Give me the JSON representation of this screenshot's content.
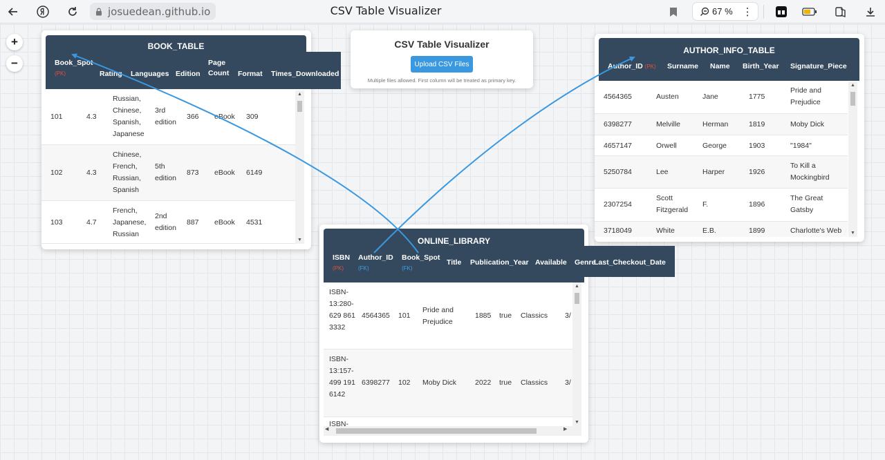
{
  "browser": {
    "domain": "josuedean.github.io",
    "tab_title": "CSV Table Visualizer",
    "zoom": "67 %",
    "menu": "⋮"
  },
  "canvas_controls": {
    "zoom_in": "+",
    "zoom_out": "−"
  },
  "uploader": {
    "title": "CSV Table Visualizer",
    "button": "Upload CSV Files",
    "hint": "Multiple files allowed. First column will be treated as primary key."
  },
  "book_table": {
    "title": "BOOK_TABLE",
    "columns": [
      {
        "label": "Book_Spot",
        "tag": "(PK)"
      },
      {
        "label": "Rating"
      },
      {
        "label": "Languages"
      },
      {
        "label": "Edition"
      },
      {
        "label": "Page Count"
      },
      {
        "label": "Format"
      },
      {
        "label": "Times_Downloaded"
      }
    ],
    "rows": [
      {
        "spot": "101",
        "rating": "4.3",
        "languages": "Russian, Chinese, Spanish, Japanese",
        "edition": "3rd edition",
        "pages": "366",
        "format": "eBook",
        "downloads": "309"
      },
      {
        "spot": "102",
        "rating": "4.3",
        "languages": "Chinese, French, Russian, Spanish",
        "edition": "5th edition",
        "pages": "873",
        "format": "eBook",
        "downloads": "6149"
      },
      {
        "spot": "103",
        "rating": "4.7",
        "languages": "French, Japanese, Russian",
        "edition": "2nd edition",
        "pages": "887",
        "format": "eBook",
        "downloads": "4531"
      }
    ]
  },
  "author_table": {
    "title": "AUTHOR_INFO_TABLE",
    "columns": [
      {
        "label": "Author_ID",
        "tag": "(PK)"
      },
      {
        "label": "Surname"
      },
      {
        "label": "Name"
      },
      {
        "label": "Birth_Year"
      },
      {
        "label": "Signature_Piece"
      }
    ],
    "rows": [
      {
        "id": "4564365",
        "surname": "Austen",
        "name": "Jane",
        "year": "1775",
        "piece": "Pride and Prejudice"
      },
      {
        "id": "6398277",
        "surname": "Melville",
        "name": "Herman",
        "year": "1819",
        "piece": "Moby Dick"
      },
      {
        "id": "4657147",
        "surname": "Orwell",
        "name": "George",
        "year": "1903",
        "piece": "\"1984\""
      },
      {
        "id": "5250784",
        "surname": "Lee",
        "name": "Harper",
        "year": "1926",
        "piece": "To Kill a Mockingbird"
      },
      {
        "id": "2307254",
        "surname": "Scott Fitzgerald",
        "name": "F.",
        "year": "1896",
        "piece": "The Great Gatsby"
      },
      {
        "id": "3718049",
        "surname": "White",
        "name": "E.B.",
        "year": "1899",
        "piece": "Charlotte's Web"
      }
    ]
  },
  "library_table": {
    "title": "ONLINE_LIBRARY",
    "columns": [
      {
        "label": "ISBN",
        "tag": "(PK)",
        "tag_type": "pk"
      },
      {
        "label": "Author_ID",
        "tag": "(FK)",
        "tag_type": "fk"
      },
      {
        "label": "Book_Spot",
        "tag": "(FK)",
        "tag_type": "fk"
      },
      {
        "label": "Title"
      },
      {
        "label": "Publication_Year"
      },
      {
        "label": "Available"
      },
      {
        "label": "Genre"
      },
      {
        "label": "Last_Checkout_Date"
      }
    ],
    "rows": [
      {
        "isbn": "ISBN-13:280-629 861 3332",
        "author": "4564365",
        "spot": "101",
        "title": "Pride and Prejudice",
        "year": "1885",
        "available": "true",
        "genre": "Classics",
        "date": "3/"
      },
      {
        "isbn": "ISBN-13:157-499 191 6142",
        "author": "6398277",
        "spot": "102",
        "title": "Moby Dick",
        "year": "2022",
        "available": "true",
        "genre": "Classics",
        "date": "3/"
      },
      {
        "isbn": "ISBN-",
        "author": "",
        "spot": "",
        "title": "",
        "year": "",
        "available": "",
        "genre": "",
        "date": ""
      }
    ]
  },
  "colors": {
    "header_bg": "#34495e",
    "connector": "#3a98e0",
    "pk_tag": "#e74c3c",
    "fk_tag": "#3ea0ea"
  }
}
